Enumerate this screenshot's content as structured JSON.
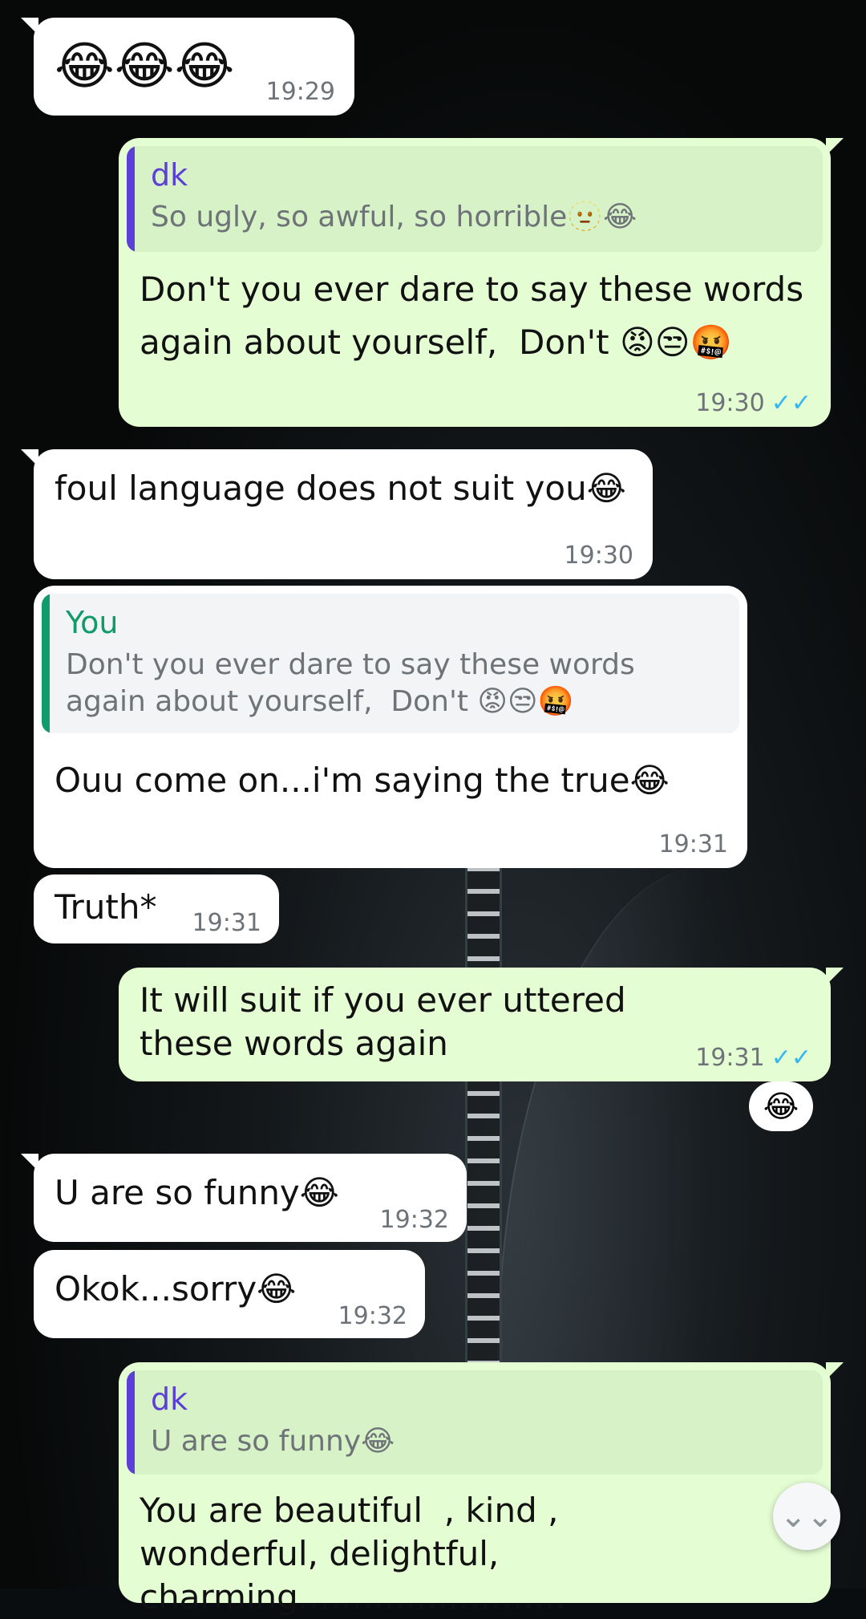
{
  "messages": {
    "m1": {
      "text": "😂😂😂",
      "time": "19:29"
    },
    "m2": {
      "reply_name": "dk",
      "reply_text": "So ugly, so awful, so horrible🫥😂",
      "text": "Don't you ever dare to say these words again about yourself,  Don't 😡😒🤬",
      "time": "19:30",
      "status": "✓✓"
    },
    "m3": {
      "text": "foul language does not suit you😂",
      "time": "19:30"
    },
    "m4": {
      "reply_name": "You",
      "reply_text": "Don't you ever dare to say these words again about yourself,  Don't 😡😒🤬",
      "text": "Ouu come on...i'm saying the true😂",
      "time": "19:31"
    },
    "m5": {
      "text": "Truth*",
      "time": "19:31"
    },
    "m6": {
      "text": "It will suit if you ever uttered these words again",
      "time": "19:31",
      "status": "✓✓",
      "reaction": "😂"
    },
    "m7": {
      "text": "U are so funny😂",
      "time": "19:32"
    },
    "m8": {
      "text": "Okok...sorry😂",
      "time": "19:32"
    },
    "m9": {
      "reply_name": "dk",
      "reply_text": "U are so funny😂",
      "text": "You are beautiful  , kind , wonderful, delightful,  charming........................."
    }
  },
  "controls": {
    "scroll_down_icon": "⌄⌄"
  },
  "colors": {
    "incoming_bubble": "#ffffff",
    "outgoing_bubble": "#e4fdd3",
    "reply_name_dk": "#5b3fd6",
    "reply_name_you": "#0f9b6a",
    "read_ticks": "#34b7f1"
  }
}
